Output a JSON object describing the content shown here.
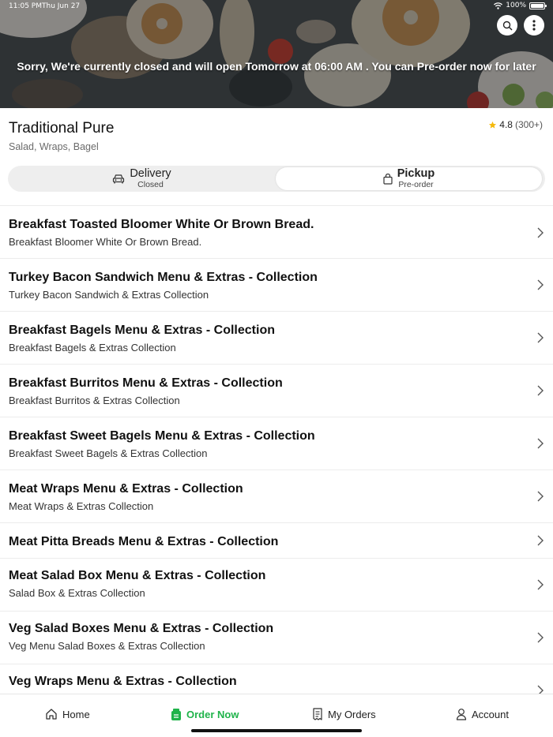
{
  "status_bar": {
    "time": "11:05 PM",
    "date": "Thu Jun 27",
    "battery": "100%"
  },
  "hero": {
    "closed_message": "Sorry, We're currently closed and will open Tomorrow at 06:00 AM . You can Pre-order now for later",
    "icons": [
      "search-icon",
      "more-vertical-icon"
    ]
  },
  "store": {
    "name": "Traditional Pure",
    "tags": "Salad, Wraps, Bagel",
    "rating": "4.8",
    "rating_count": "(300+)"
  },
  "order_mode": {
    "delivery": {
      "label": "Delivery",
      "status": "Closed"
    },
    "pickup": {
      "label": "Pickup",
      "status": "Pre-order"
    },
    "selected": "pickup"
  },
  "menu": [
    {
      "title": "Breakfast Toasted Bloomer White Or Brown Bread.",
      "subtitle": "Breakfast Bloomer White Or Brown Bread."
    },
    {
      "title": "Turkey Bacon Sandwich Menu & Extras - Collection",
      "subtitle": "Turkey Bacon Sandwich & Extras Collection"
    },
    {
      "title": "Breakfast Bagels Menu & Extras - Collection",
      "subtitle": "Breakfast Bagels & Extras Collection"
    },
    {
      "title": "Breakfast Burritos Menu & Extras - Collection",
      "subtitle": "Breakfast Burritos & Extras Collection"
    },
    {
      "title": "Breakfast Sweet Bagels Menu & Extras - Collection",
      "subtitle": "Breakfast Sweet Bagels & Extras Collection"
    },
    {
      "title": "Meat Wraps Menu & Extras - Collection",
      "subtitle": "Meat Wraps & Extras Collection"
    },
    {
      "title": "Meat Pitta Breads Menu & Extras - Collection",
      "subtitle": ""
    },
    {
      "title": "Meat Salad Box Menu & Extras - Collection",
      "subtitle": "Salad Box & Extras Collection"
    },
    {
      "title": "Veg Salad Boxes Menu & Extras - Collection",
      "subtitle": "Veg Menu Salad Boxes & Extras Collection"
    },
    {
      "title": "Veg Wraps Menu & Extras - Collection",
      "subtitle": ""
    }
  ],
  "bottom_nav": {
    "home": "Home",
    "order_now": "Order Now",
    "my_orders": "My Orders",
    "account": "Account",
    "active": "order_now"
  },
  "colors": {
    "accent": "#1fb34a",
    "star": "#f5b90b"
  }
}
